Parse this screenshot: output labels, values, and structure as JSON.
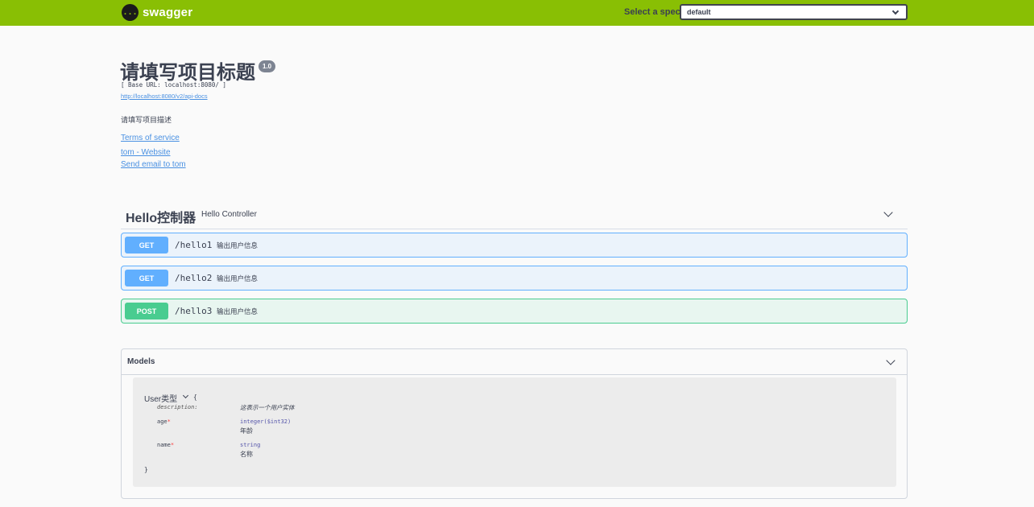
{
  "topbar": {
    "logo_icon": "{...}",
    "logo_text": "swagger",
    "spec_label": "Select a spec",
    "spec_value": "default"
  },
  "info": {
    "title": "请填写项目标题",
    "version": "1.0",
    "base_url": "[ Base URL: localhost:8080/ ]",
    "docs_url": "http://localhost:8080/v2/api-docs",
    "description": "请填写项目描述",
    "terms": "Terms of service",
    "website": "tom - Website",
    "email": "Send email to tom"
  },
  "tag": {
    "name": "Hello控制器",
    "description": "Hello Controller"
  },
  "operations": [
    {
      "method": "GET",
      "path": "/hello1",
      "summary": "输出用户信息"
    },
    {
      "method": "GET",
      "path": "/hello2",
      "summary": "输出用户信息"
    },
    {
      "method": "POST",
      "path": "/hello3",
      "summary": "输出用户信息"
    }
  ],
  "models": {
    "title": "Models",
    "model": {
      "name": "User类型",
      "open_brace": "{",
      "close_brace": "}",
      "description_key": "description:",
      "description_value": "这表示一个用户实体",
      "properties": [
        {
          "name": "age",
          "required": "*",
          "type": "integer($int32)",
          "description": "年龄"
        },
        {
          "name": "name",
          "required": "*",
          "type": "string",
          "description": "名称"
        }
      ]
    }
  },
  "colors": {
    "topbar": "#89bf04",
    "get": "#61affe",
    "post": "#49cc90",
    "link": "#4990e2"
  }
}
